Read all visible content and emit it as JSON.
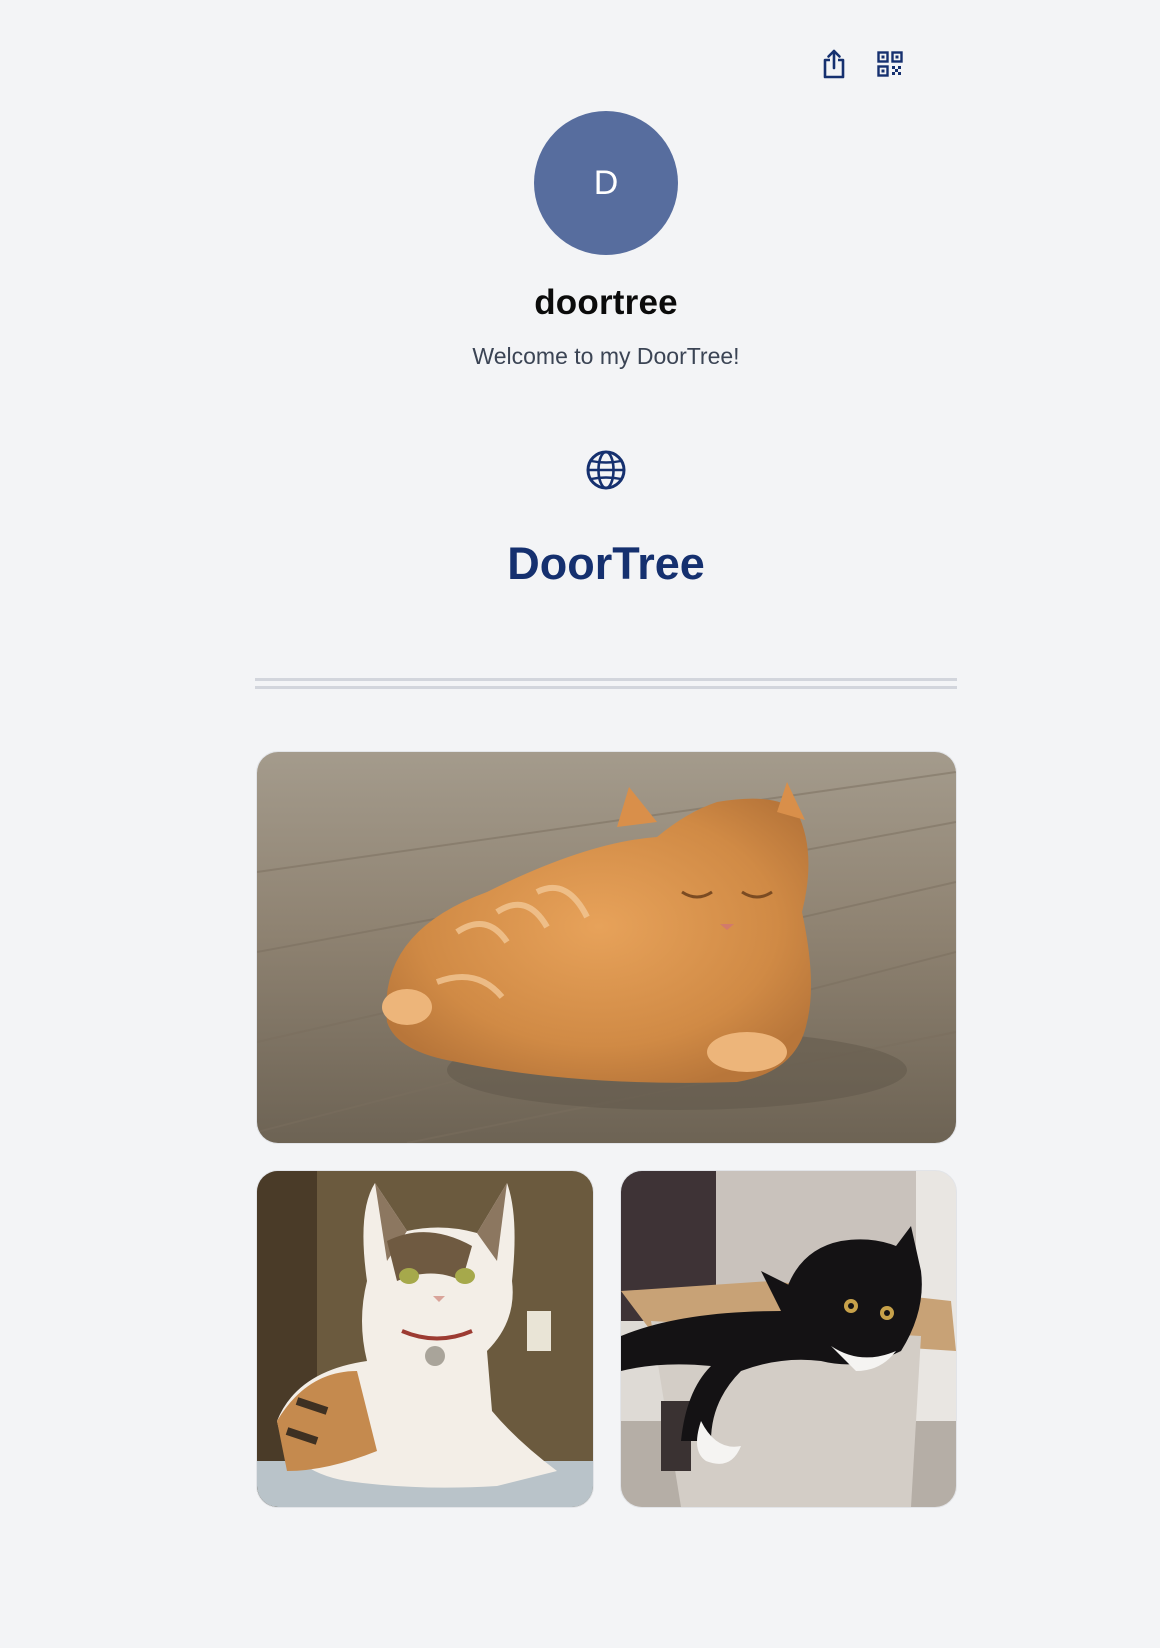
{
  "header": {
    "share_icon": "share-icon",
    "qr_icon": "qr-code-icon"
  },
  "profile": {
    "avatar_initial": "D",
    "name": "doortree",
    "bio": "Welcome to my DoorTree!",
    "avatar_color": "#576d9e"
  },
  "links": {
    "globe_icon": "globe-icon",
    "site_title": "DoorTree",
    "accent_color": "#15306f"
  },
  "gallery": {
    "photos": [
      {
        "name": "photo-orange-tabby-cat"
      },
      {
        "name": "photo-calico-cat"
      },
      {
        "name": "photo-tuxedo-cat-in-box"
      }
    ]
  }
}
